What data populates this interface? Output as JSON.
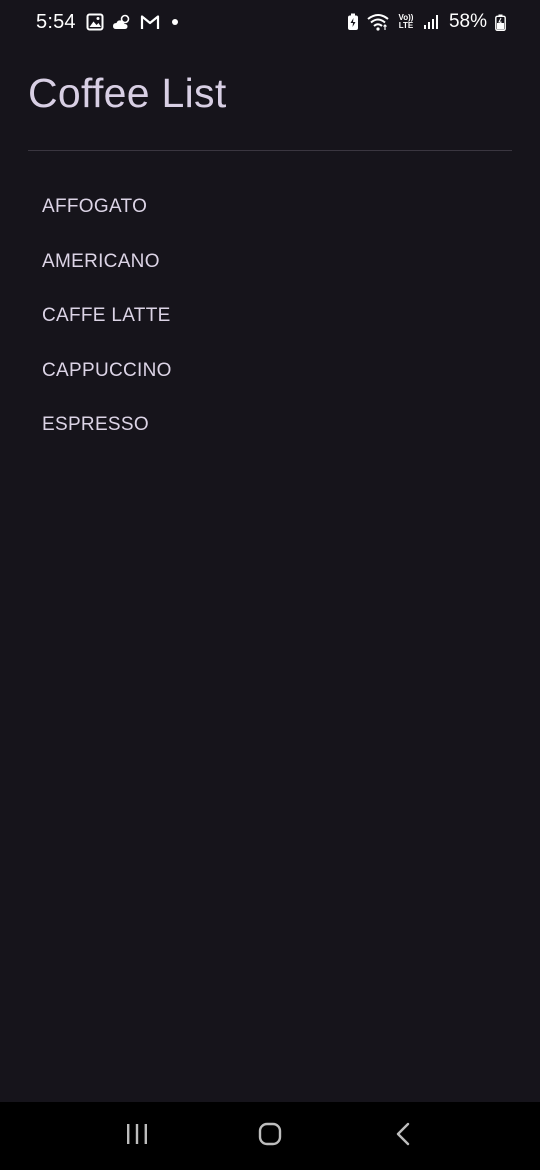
{
  "status_bar": {
    "time": "5:54",
    "battery": "58%",
    "network": "Vo)) LTE",
    "left_icons": [
      "gallery-icon",
      "cloud-sun-icon",
      "gmail-icon",
      "notification-dot-icon"
    ],
    "right_icons": [
      "battery-saver-icon",
      "wifi-icon",
      "volte-icon",
      "signal-icon",
      "battery-icon"
    ]
  },
  "page": {
    "title": "Coffee List"
  },
  "coffees": [
    {
      "name": "AFFOGATO"
    },
    {
      "name": "AMERICANO"
    },
    {
      "name": "CAFFE LATTE"
    },
    {
      "name": "CAPPUCCINO"
    },
    {
      "name": "ESPRESSO"
    }
  ],
  "nav_bar": {
    "icons": [
      "recent-apps-icon",
      "home-icon",
      "back-icon"
    ]
  },
  "colors": {
    "background": "#16141b",
    "title": "#d8cfe4",
    "list_text": "#dcd4e6",
    "divider": "#3a3640",
    "nav_background": "#000000"
  }
}
